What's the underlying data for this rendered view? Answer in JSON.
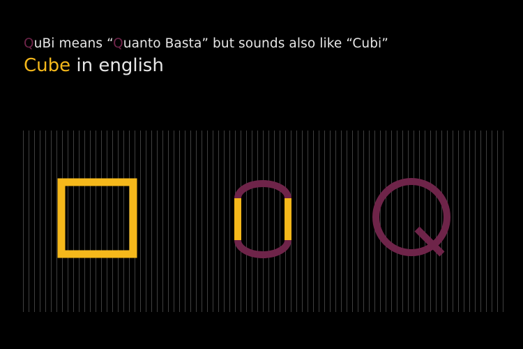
{
  "headline": {
    "line1": [
      {
        "text": "Q",
        "color": "#6e2449"
      },
      {
        "text": "uBi means “",
        "color": "#e6e6e6"
      },
      {
        "text": "Q",
        "color": "#6e2449"
      },
      {
        "text": "uanto Basta” but sounds also like “Cubi”",
        "color": "#e6e6e6"
      }
    ],
    "line2": [
      {
        "text": "Cube",
        "color": "#f5b81b"
      },
      {
        "text": " in english",
        "color": "#e6e6e6"
      }
    ]
  },
  "colors": {
    "background": "#000000",
    "text": "#e6e6e6",
    "brand_purple": "#6e2449",
    "brand_yellow": "#f5b81b",
    "grid": "#565656"
  },
  "glyphs": [
    "cube-square",
    "cubi-rounded-o",
    "letter-q"
  ]
}
